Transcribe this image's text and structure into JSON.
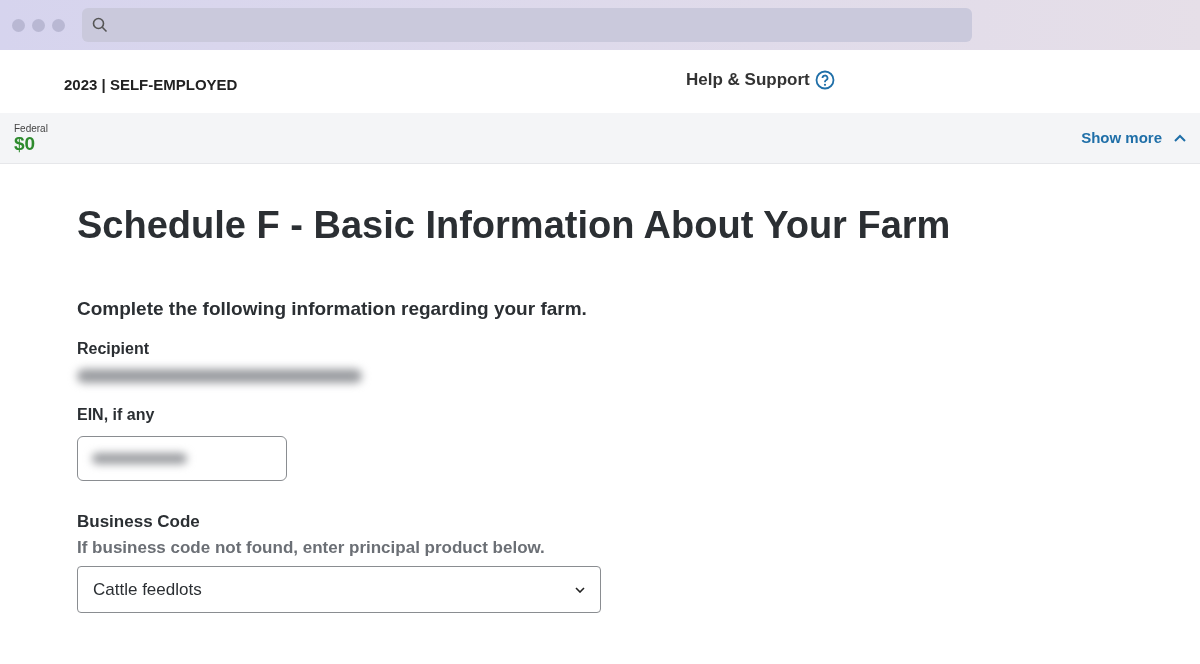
{
  "header": {
    "title": "2023 | SELF-EMPLOYED",
    "help_link": "Help & Support"
  },
  "refund_bar": {
    "label": "Federal",
    "amount": "$0",
    "toggle": "Show more",
    "expanded": true
  },
  "page": {
    "heading": "Schedule F - Basic Information About Your Farm",
    "intro": "Complete the following information regarding your farm."
  },
  "recipient": {
    "label": "Recipient",
    "redacted": true
  },
  "ein": {
    "label": "EIN, if any",
    "redacted": true
  },
  "business_code": {
    "label": "Business Code",
    "hint": "If business code not found, enter principal product below.",
    "value": "Cattle feedlots"
  }
}
